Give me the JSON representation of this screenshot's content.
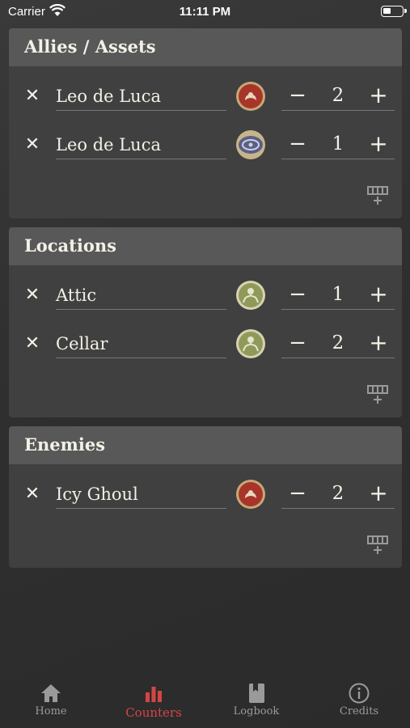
{
  "status_bar": {
    "carrier": "Carrier",
    "time": "11:11 PM"
  },
  "sections": [
    {
      "title": "Allies / Assets",
      "rows": [
        {
          "name": "Leo de Luca",
          "token": "seal-token-red",
          "count": "2"
        },
        {
          "name": "Leo de Luca",
          "token": "seal-token-blue",
          "count": "1"
        }
      ]
    },
    {
      "title": "Locations",
      "rows": [
        {
          "name": "Attic",
          "token": "location-token-green",
          "count": "1"
        },
        {
          "name": "Cellar",
          "token": "location-token-green",
          "count": "2"
        }
      ]
    },
    {
      "title": "Enemies",
      "rows": [
        {
          "name": "Icy Ghoul",
          "token": "seal-token-red",
          "count": "2"
        }
      ]
    }
  ],
  "stepper": {
    "minus": "−",
    "plus": "+"
  },
  "remove_glyph": "✕",
  "tabs": [
    {
      "label": "Home",
      "icon": "home-icon",
      "active": false
    },
    {
      "label": "Counters",
      "icon": "bar-chart-icon",
      "active": true
    },
    {
      "label": "Logbook",
      "icon": "book-icon",
      "active": false
    },
    {
      "label": "Credits",
      "icon": "info-icon",
      "active": false
    }
  ],
  "colors": {
    "accent": "#d64545",
    "panel": "#404040",
    "header": "#585858"
  }
}
